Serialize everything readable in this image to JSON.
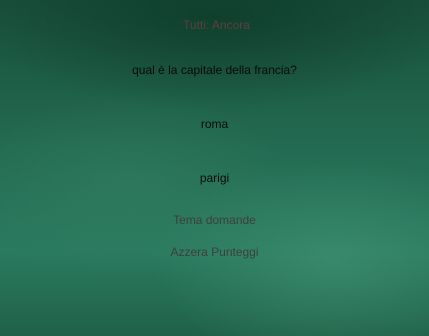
{
  "score": {
    "label": "Tutti: Ancora"
  },
  "quiz": {
    "question": "qual è la capitale della francia?",
    "answers": [
      {
        "label": "roma"
      },
      {
        "label": "parigi"
      }
    ]
  },
  "menu": {
    "theme_label": "Tema domande",
    "reset_label": "Azzera Punteggi"
  },
  "colors": {
    "background": "#236b52",
    "text": "#0a0a0a",
    "muted": "#3e3e3e",
    "score": "#5a4040"
  }
}
